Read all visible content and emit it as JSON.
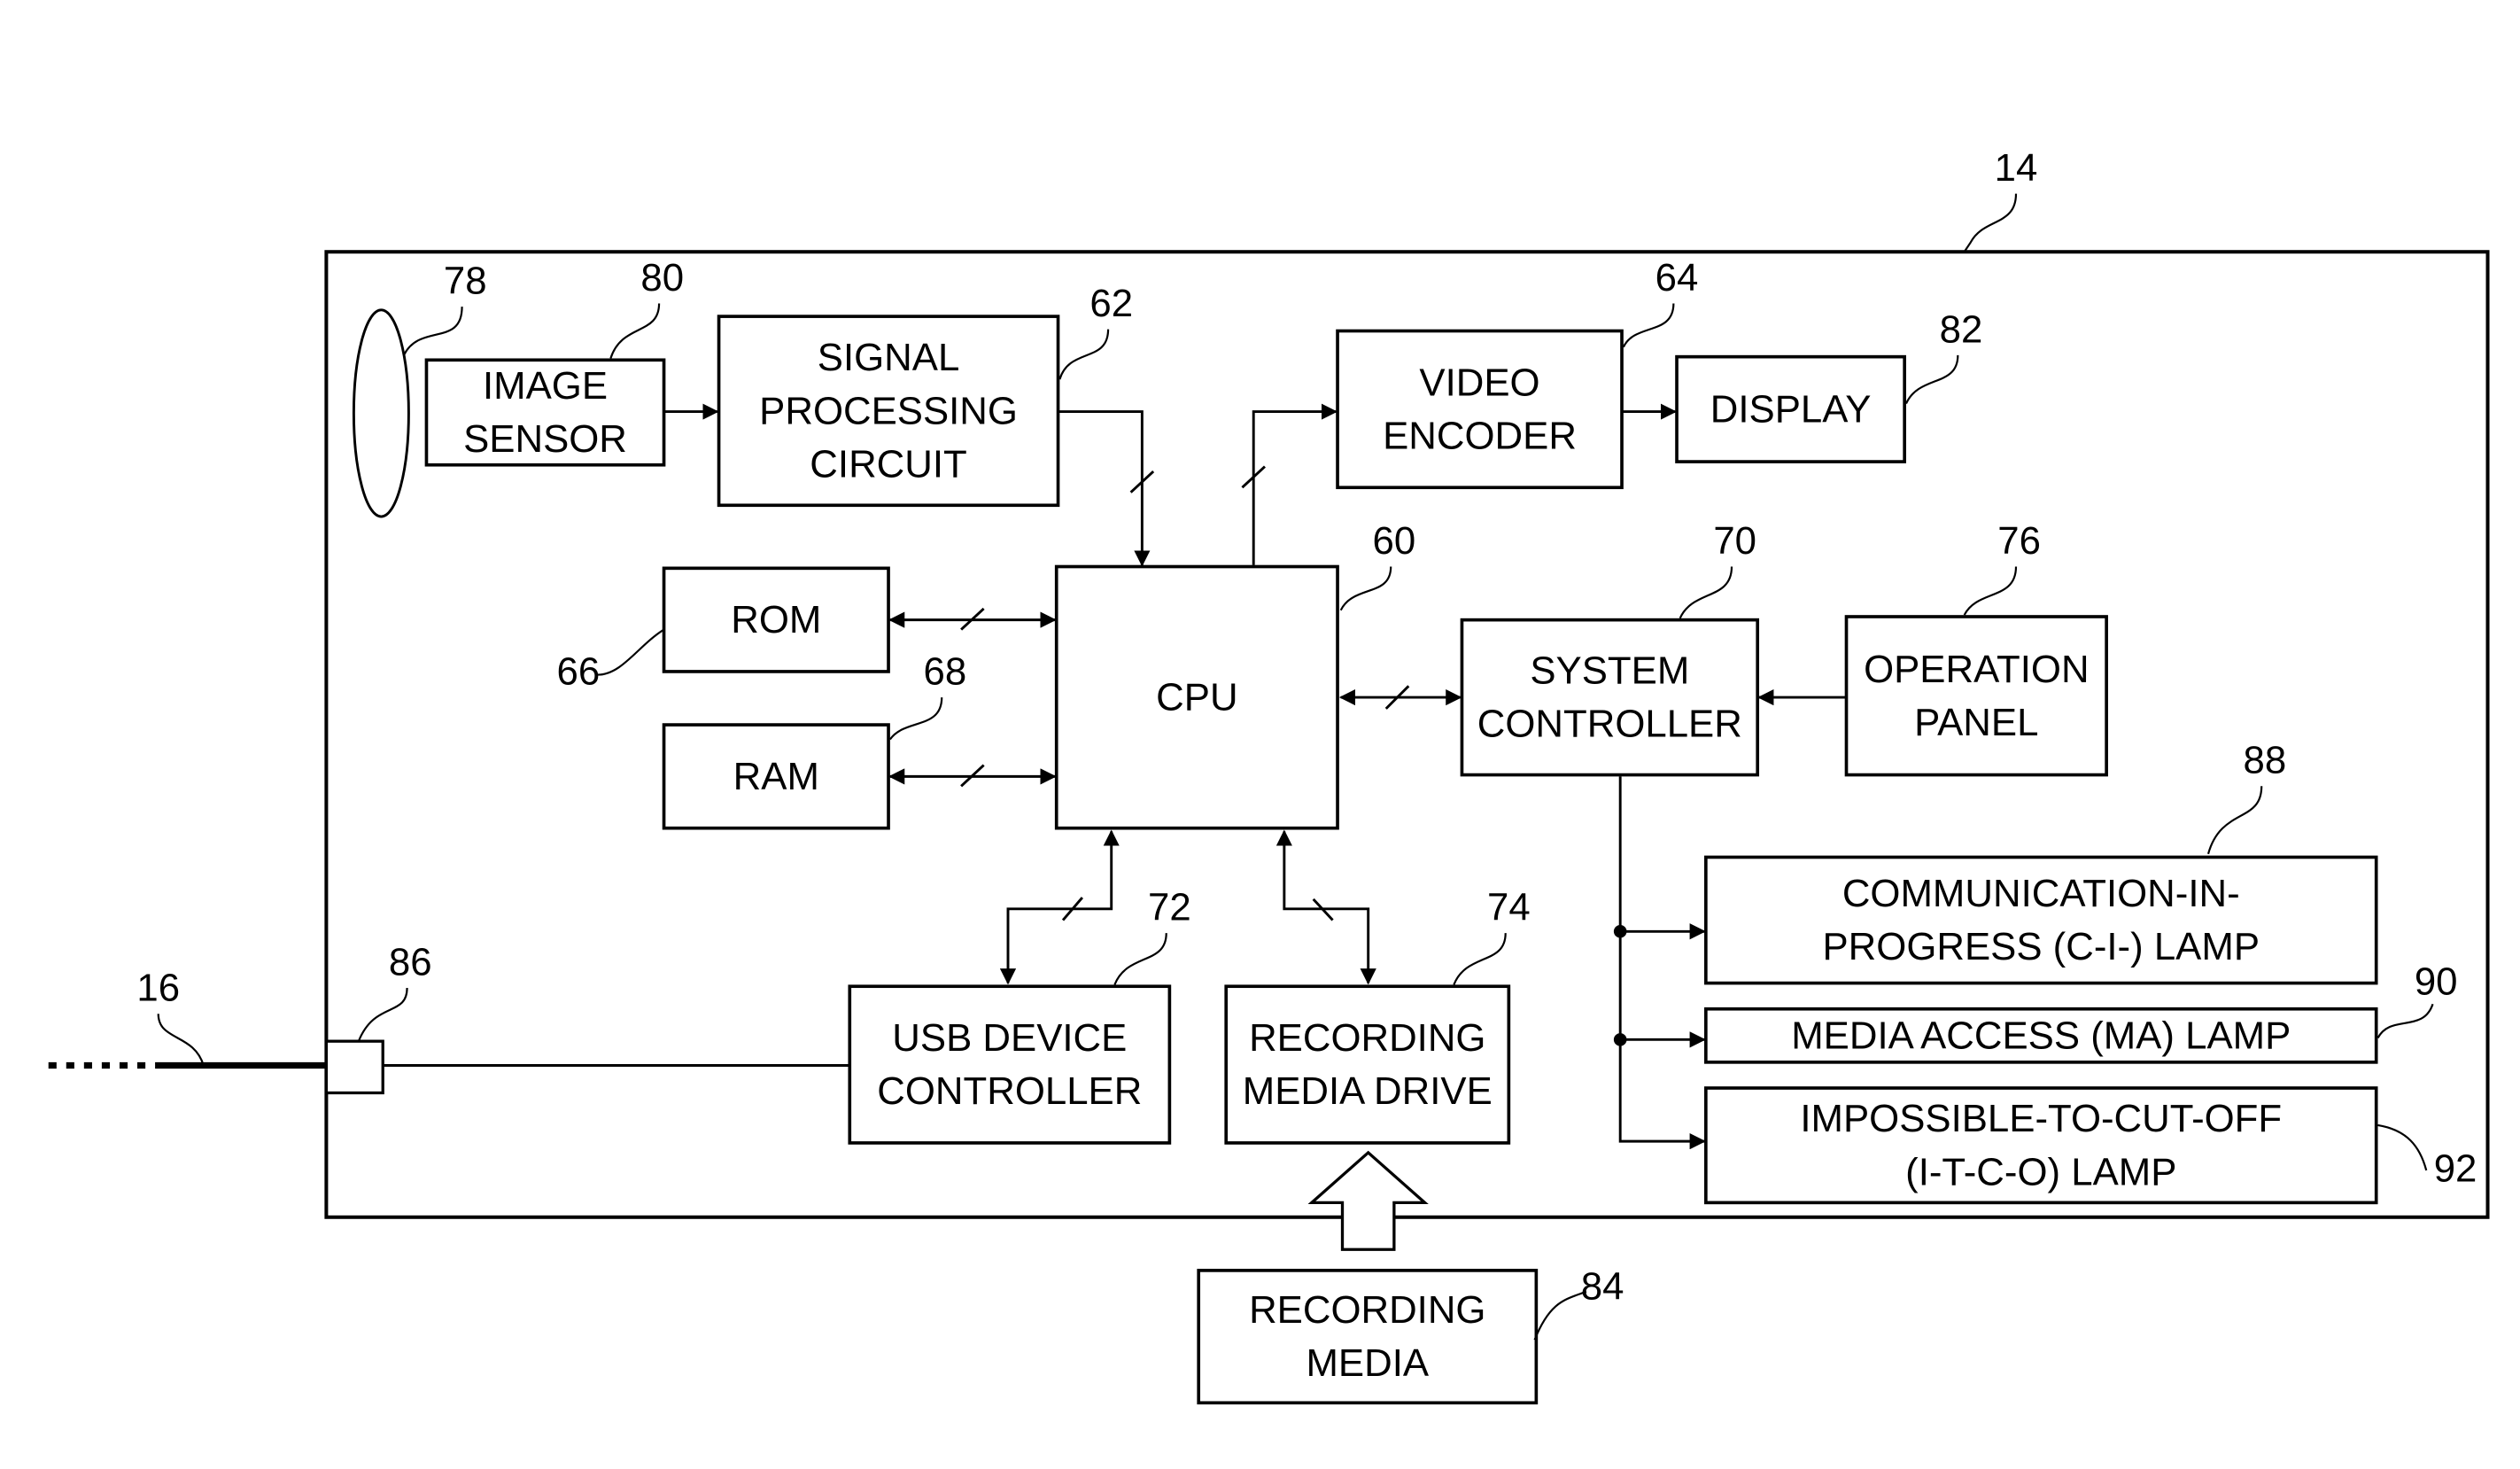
{
  "figure": {
    "enclosure_ref": "14",
    "cable_ref": "16",
    "connector_ref": "86",
    "lens_ref": "78"
  },
  "blocks": {
    "image_sensor": {
      "ref": "80",
      "lines": [
        "IMAGE",
        "SENSOR"
      ]
    },
    "signal_processing": {
      "ref": "62",
      "lines": [
        "SIGNAL",
        "PROCESSING",
        "CIRCUIT"
      ]
    },
    "video_encoder": {
      "ref": "64",
      "lines": [
        "VIDEO",
        "ENCODER"
      ]
    },
    "display": {
      "ref": "82",
      "lines": [
        "DISPLAY"
      ]
    },
    "rom": {
      "ref": "66",
      "lines": [
        "ROM"
      ]
    },
    "ram": {
      "ref": "68",
      "lines": [
        "RAM"
      ]
    },
    "cpu": {
      "ref": "60",
      "lines": [
        "CPU"
      ]
    },
    "system_controller": {
      "ref": "70",
      "lines": [
        "SYSTEM",
        "CONTROLLER"
      ]
    },
    "operation_panel": {
      "ref": "76",
      "lines": [
        "OPERATION",
        "PANEL"
      ]
    },
    "usb_device_controller": {
      "ref": "72",
      "lines": [
        "USB DEVICE",
        "CONTROLLER"
      ]
    },
    "recording_media_drive": {
      "ref": "74",
      "lines": [
        "RECORDING",
        "MEDIA DRIVE"
      ]
    },
    "recording_media": {
      "ref": "84",
      "lines": [
        "RECORDING",
        "MEDIA"
      ]
    },
    "ci_lamp": {
      "ref": "88",
      "lines": [
        "COMMUNICATION-IN-",
        "PROGRESS (C-I-) LAMP"
      ]
    },
    "ma_lamp": {
      "ref": "90",
      "lines": [
        "MEDIA ACCESS (MA) LAMP"
      ]
    },
    "itco_lamp": {
      "ref": "92",
      "lines": [
        "IMPOSSIBLE-TO-CUT-OFF",
        "(I-T-C-O) LAMP"
      ]
    }
  }
}
